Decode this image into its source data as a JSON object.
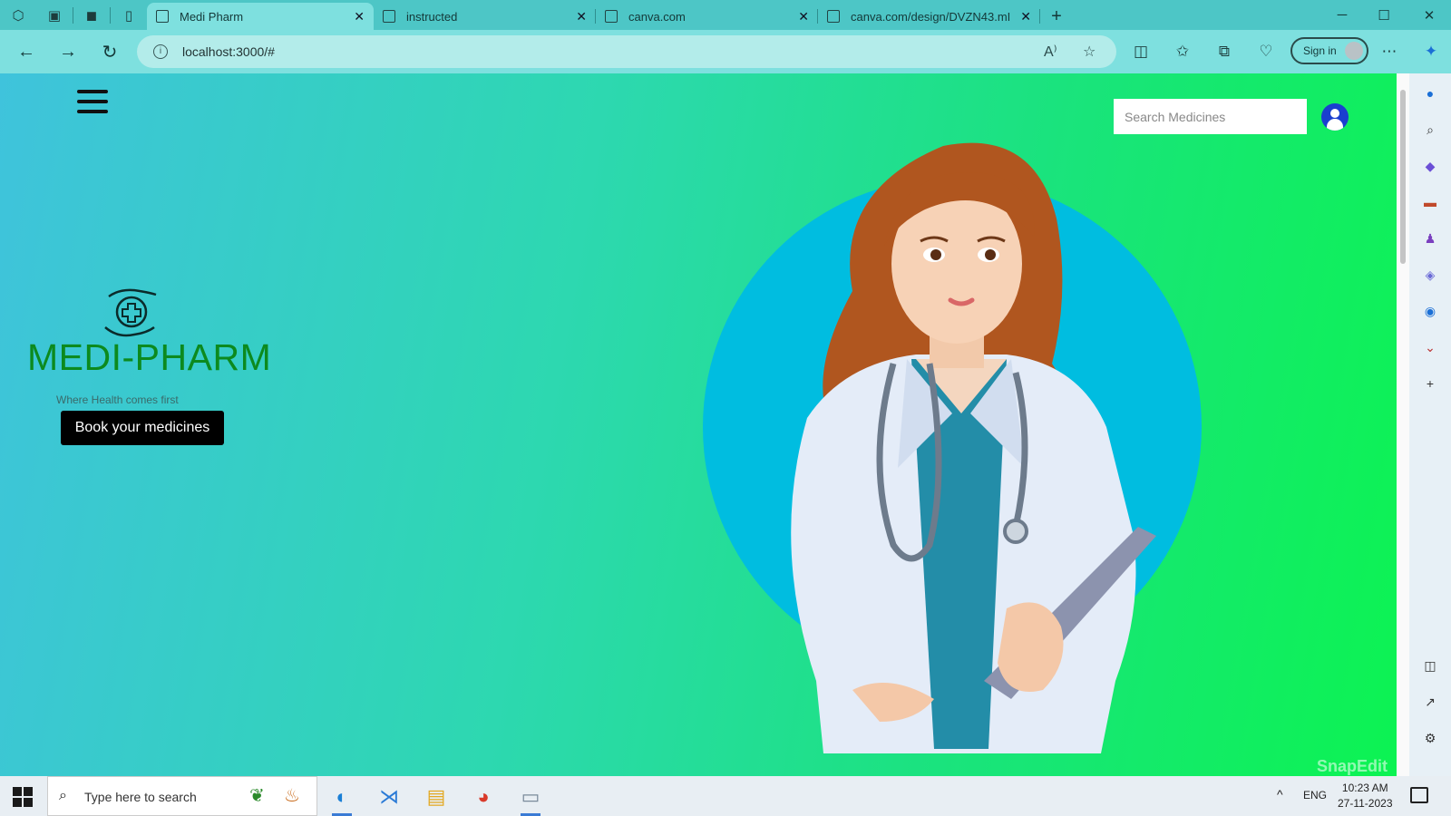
{
  "browser": {
    "tabs": [
      {
        "label": "Medi Pharm",
        "active": true
      },
      {
        "label": "instructed",
        "active": false
      },
      {
        "label": "canva.com",
        "active": false
      },
      {
        "label": "canva.com/design/DVZN43.mI",
        "active": false
      }
    ],
    "url": "localhost:3000/#",
    "signin_label": "Sign in"
  },
  "page": {
    "search_placeholder": "Search Medicines",
    "brand_name": "MEDI-PHARM",
    "tagline": "Where Health comes first",
    "book_button": "Book your medicines"
  },
  "watermark": "SnapEdit",
  "taskbar": {
    "search_placeholder": "Type here to search",
    "lang": "ENG",
    "time": "10:23 AM",
    "date": "27-11-2023"
  },
  "colors": {
    "brand_green": "#0c8a1e",
    "gradient_start": "#3fc3dc",
    "gradient_end": "#0cf352",
    "hero_circle": "#00bde0"
  },
  "icons": [
    "hamburger-icon",
    "user-icon",
    "pharmacy-hands-icon",
    "search-icon",
    "back-icon",
    "forward-icon",
    "refresh-icon",
    "start-icon"
  ]
}
